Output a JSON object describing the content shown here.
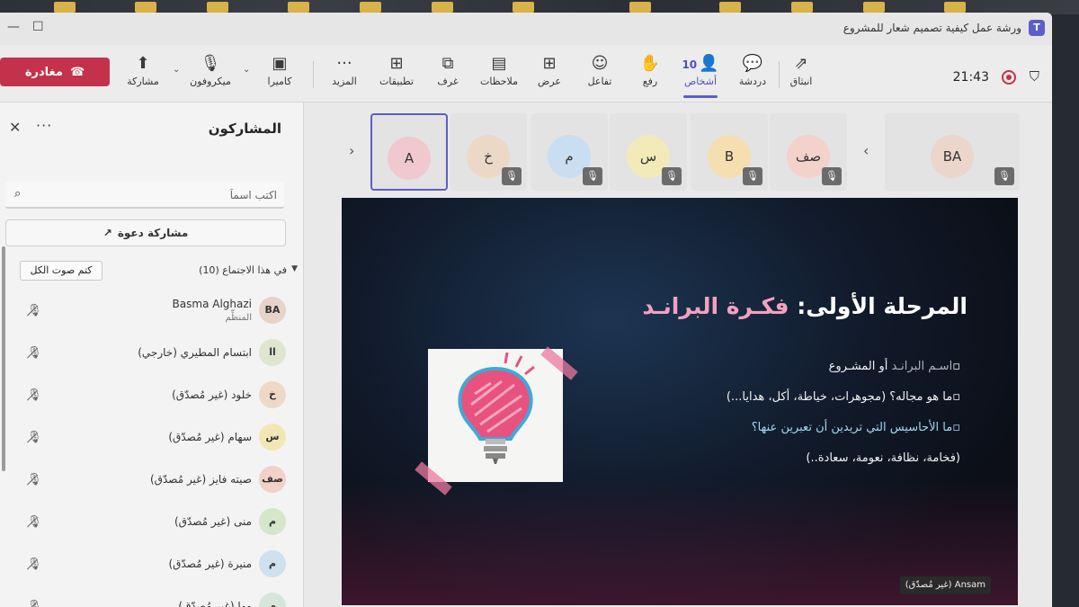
{
  "window": {
    "title": "ورشة عمل كيفية تصميم شعار للمشروع"
  },
  "toolbar": {
    "leave_label": "مغادرة",
    "share_label": "مشاركة",
    "mic_label": "ميكروفون",
    "camera_label": "كاميرا",
    "more_label": "المزيد",
    "apps_label": "تطبيقات",
    "rooms_label": "غرف",
    "notes_label": "ملاحظات",
    "view_label": "عرض",
    "react_label": "تفاعل",
    "raise_label": "رفع",
    "people_label": "أشخاص",
    "people_count": "10",
    "chat_label": "دردشة",
    "popout_label": "انبثاق",
    "clock": "21:43"
  },
  "panel": {
    "title": "المشاركون",
    "search_placeholder": "اكتب اسماً",
    "invite_label": "مشاركة دعوة",
    "section_label": "في هذا الاجتماع (10)",
    "mute_all_label": "كتم صوت الكل",
    "participants": [
      {
        "initials": "BA",
        "name": "Basma Alghazi",
        "role": "المنظِّم",
        "color": "#e6d3c9"
      },
      {
        "initials": "اا",
        "name": "ابتسام المطيري (خارجي)",
        "role": "",
        "color": "#dfe6cf"
      },
      {
        "initials": "خ",
        "name": "خلود (غير مُصدّق)",
        "role": "",
        "color": "#eed9c6"
      },
      {
        "initials": "س",
        "name": "سهام (غير مُصدّق)",
        "role": "",
        "color": "#f1e7b4"
      },
      {
        "initials": "صف",
        "name": "صيته فايز (غير مُصدّق)",
        "role": "",
        "color": "#f1d1c8"
      },
      {
        "initials": "م",
        "name": "منى (غير مُصدّق)",
        "role": "",
        "color": "#d5e7c9"
      },
      {
        "initials": "م",
        "name": "منيرة (غير مُصدّق)",
        "role": "",
        "color": "#cfe0ef"
      },
      {
        "initials": "م",
        "name": "مها (غير مُصدّق)",
        "role": "",
        "color": "#d8e6d9"
      }
    ]
  },
  "tiles": [
    {
      "initials": "A",
      "color": "#f0c9ce",
      "muted": false,
      "focused": true
    },
    {
      "initials": "خ",
      "color": "#ecd8c6",
      "muted": true,
      "focused": false
    },
    {
      "initials": "م",
      "color": "#c9def0",
      "muted": true,
      "focused": false
    },
    {
      "initials": "س",
      "color": "#f2ebb9",
      "muted": true,
      "focused": false
    },
    {
      "initials": "B",
      "color": "#f5dfb0",
      "muted": true,
      "focused": false
    },
    {
      "initials": "صف",
      "color": "#f2d2cb",
      "muted": true,
      "focused": false
    },
    {
      "initials": "BA",
      "color": "#ead6cb",
      "muted": true,
      "focused": false
    }
  ],
  "slide": {
    "title_main": "المرحلة الأولى:",
    "title_accent": "فكـرة البرانـد",
    "bullet1_dim": "اسـم البرانـد",
    "bullet1_rest": "أو المشـروع",
    "bullet2": "ما هو مجاله؟ (مجوهرات، خياطة، أكل، هدايا...)",
    "bullet3": "ما الأحاسيس التي تريدين أن تعبرين عنها؟",
    "bullet4": "(فخامة، نظافة، نعومة، سعادة..)",
    "presenter": "Ansam (غير مُصدّق)"
  },
  "colors": {
    "brand": "#5b5fc7",
    "leave": "#c4314b",
    "slide_accent": "#f2a1c1"
  }
}
